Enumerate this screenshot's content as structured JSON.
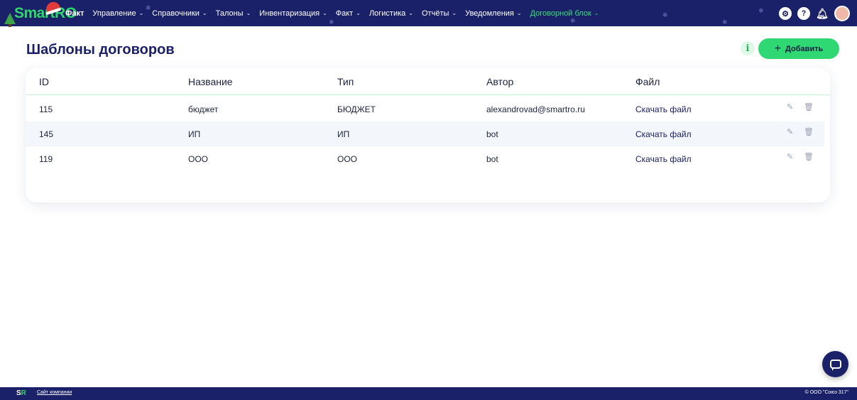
{
  "brand": {
    "logo_text": "Smart",
    "logo_ro": "RO",
    "footer_logo_s": "S",
    "footer_logo_r": "R"
  },
  "nav": {
    "items": [
      {
        "label": "Факт",
        "has_chevron": false
      },
      {
        "label": "Управление",
        "has_chevron": true
      },
      {
        "label": "Справочники",
        "has_chevron": true
      },
      {
        "label": "Талоны",
        "has_chevron": true
      },
      {
        "label": "Инвентаризация",
        "has_chevron": true
      },
      {
        "label": "Факт",
        "has_chevron": true
      },
      {
        "label": "Логистика",
        "has_chevron": true
      },
      {
        "label": "Отчёты",
        "has_chevron": true
      },
      {
        "label": "Уведомления",
        "has_chevron": true
      },
      {
        "label": "Договорной блок",
        "has_chevron": true,
        "active": true
      }
    ],
    "icons": [
      "settings-icon",
      "help-icon",
      "bell-icon",
      "user-avatar"
    ]
  },
  "page": {
    "title": "Шаблоны договоров",
    "info_label": "i",
    "add_plus": "+",
    "add_label": "Добавить"
  },
  "table": {
    "headers": [
      "ID",
      "Название",
      "Тип",
      "Автор",
      "Файл"
    ],
    "rows": [
      {
        "id": "115",
        "name": "бюджет",
        "type": "БЮДЖЕТ",
        "author": "alexandrovad@smartro.ru",
        "file": "Скачать файл"
      },
      {
        "id": "145",
        "name": "ИП",
        "type": "ИП",
        "author": "bot",
        "file": "Скачать файл"
      },
      {
        "id": "119",
        "name": "ООО",
        "type": "ООО",
        "author": "bot",
        "file": "Скачать файл"
      }
    ]
  },
  "footer": {
    "link": "Сайт компании",
    "copyright": "© ООО \"Союз 317\""
  },
  "colors": {
    "nav_bg": "#1b2169",
    "accent_green": "#2fd873",
    "row_alt": "#f3f7fb"
  }
}
